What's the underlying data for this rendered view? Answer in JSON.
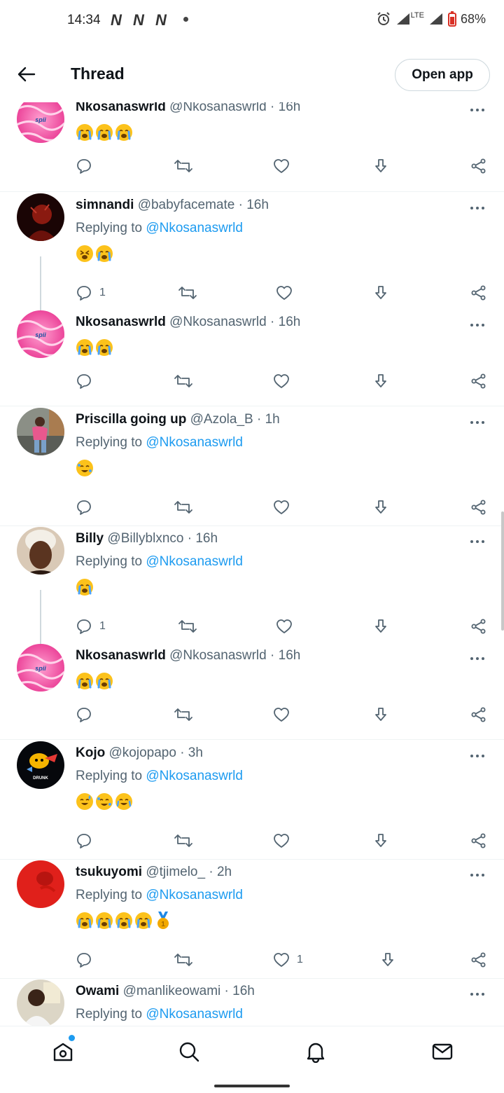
{
  "status_bar": {
    "time": "14:34",
    "notif_icons": [
      "N",
      "N",
      "N"
    ],
    "network": "LTE",
    "battery": "68%"
  },
  "header": {
    "title": "Thread",
    "open_app": "Open app"
  },
  "colors": {
    "accent": "#1d9bf0",
    "text": "#0f1419",
    "muted": "#536471",
    "divider": "#eff3f4"
  },
  "tweets": [
    {
      "name": "Nkosanaswrld",
      "handle": "@Nkosanaswrld",
      "time": "· 16h",
      "reply_prefix": "",
      "reply_to": "",
      "emojis": [
        "loudly-crying",
        "loudly-crying",
        "loudly-crying"
      ],
      "replies": "",
      "likes": ""
    },
    {
      "name": "simnandi",
      "handle": "@babyfacemate",
      "time": "· 16h",
      "reply_prefix": "Replying to",
      "reply_to": "@Nkosanaswrld",
      "emojis": [
        "weary",
        "loudly-crying"
      ],
      "replies": "1",
      "likes": ""
    },
    {
      "name": "Nkosanaswrld",
      "handle": "@Nkosanaswrld",
      "time": "· 16h",
      "reply_prefix": "",
      "reply_to": "",
      "emojis": [
        "loudly-crying",
        "loudly-crying"
      ],
      "replies": "",
      "likes": ""
    },
    {
      "name": "Priscilla going up",
      "handle": "@Azola_B",
      "time": "· 1h",
      "reply_prefix": "Replying to",
      "reply_to": "@Nkosanaswrld",
      "emojis": [
        "rofl"
      ],
      "replies": "",
      "likes": ""
    },
    {
      "name": "Billy",
      "handle": "@Billyblxnco",
      "time": "· 16h",
      "reply_prefix": "Replying to",
      "reply_to": "@Nkosanaswrld",
      "emojis": [
        "loudly-crying"
      ],
      "replies": "1",
      "likes": ""
    },
    {
      "name": "Nkosanaswrld",
      "handle": "@Nkosanaswrld",
      "time": "· 16h",
      "reply_prefix": "",
      "reply_to": "",
      "emojis": [
        "loudly-crying",
        "loudly-crying"
      ],
      "replies": "",
      "likes": ""
    },
    {
      "name": "Kojo",
      "handle": "@kojopapo",
      "time": "· 3h",
      "reply_prefix": "Replying to",
      "reply_to": "@Nkosanaswrld",
      "emojis": [
        "sweat-smile",
        "rofl",
        "joy"
      ],
      "replies": "",
      "likes": ""
    },
    {
      "name": "tsukuyomi",
      "handle": "@tjimelo_",
      "time": "· 2h",
      "reply_prefix": "Replying to",
      "reply_to": "@Nkosanaswrld",
      "emojis": [
        "loudly-crying",
        "loudly-crying",
        "loudly-crying",
        "loudly-crying",
        "gold-medal"
      ],
      "replies": "",
      "likes": "1"
    },
    {
      "name": "Owami",
      "handle": "@manlikeowami",
      "time": "· 16h",
      "reply_prefix": "Replying to",
      "reply_to": "@Nkosanaswrld",
      "emojis": [],
      "replies": "",
      "likes": ""
    }
  ]
}
